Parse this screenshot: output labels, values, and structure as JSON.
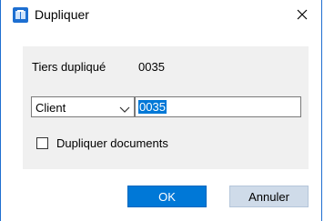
{
  "window": {
    "title": "Dupliquer",
    "app_icon": "app-dialog-icon",
    "close_icon": "close-icon"
  },
  "form": {
    "tiers_label": "Tiers dupliqué",
    "tiers_value": "0035",
    "type_select": {
      "selected": "Client",
      "icon": "chevron-down-icon"
    },
    "code_input": {
      "value": "0035",
      "selected": true
    },
    "duplicate_documents": {
      "label": "Dupliquer documents",
      "checked": false
    }
  },
  "buttons": {
    "ok_label": "OK",
    "cancel_label": "Annuler"
  },
  "colors": {
    "accent": "#0078d7",
    "panel": "#f0f0f0",
    "window_border": "#1f6fd0"
  }
}
